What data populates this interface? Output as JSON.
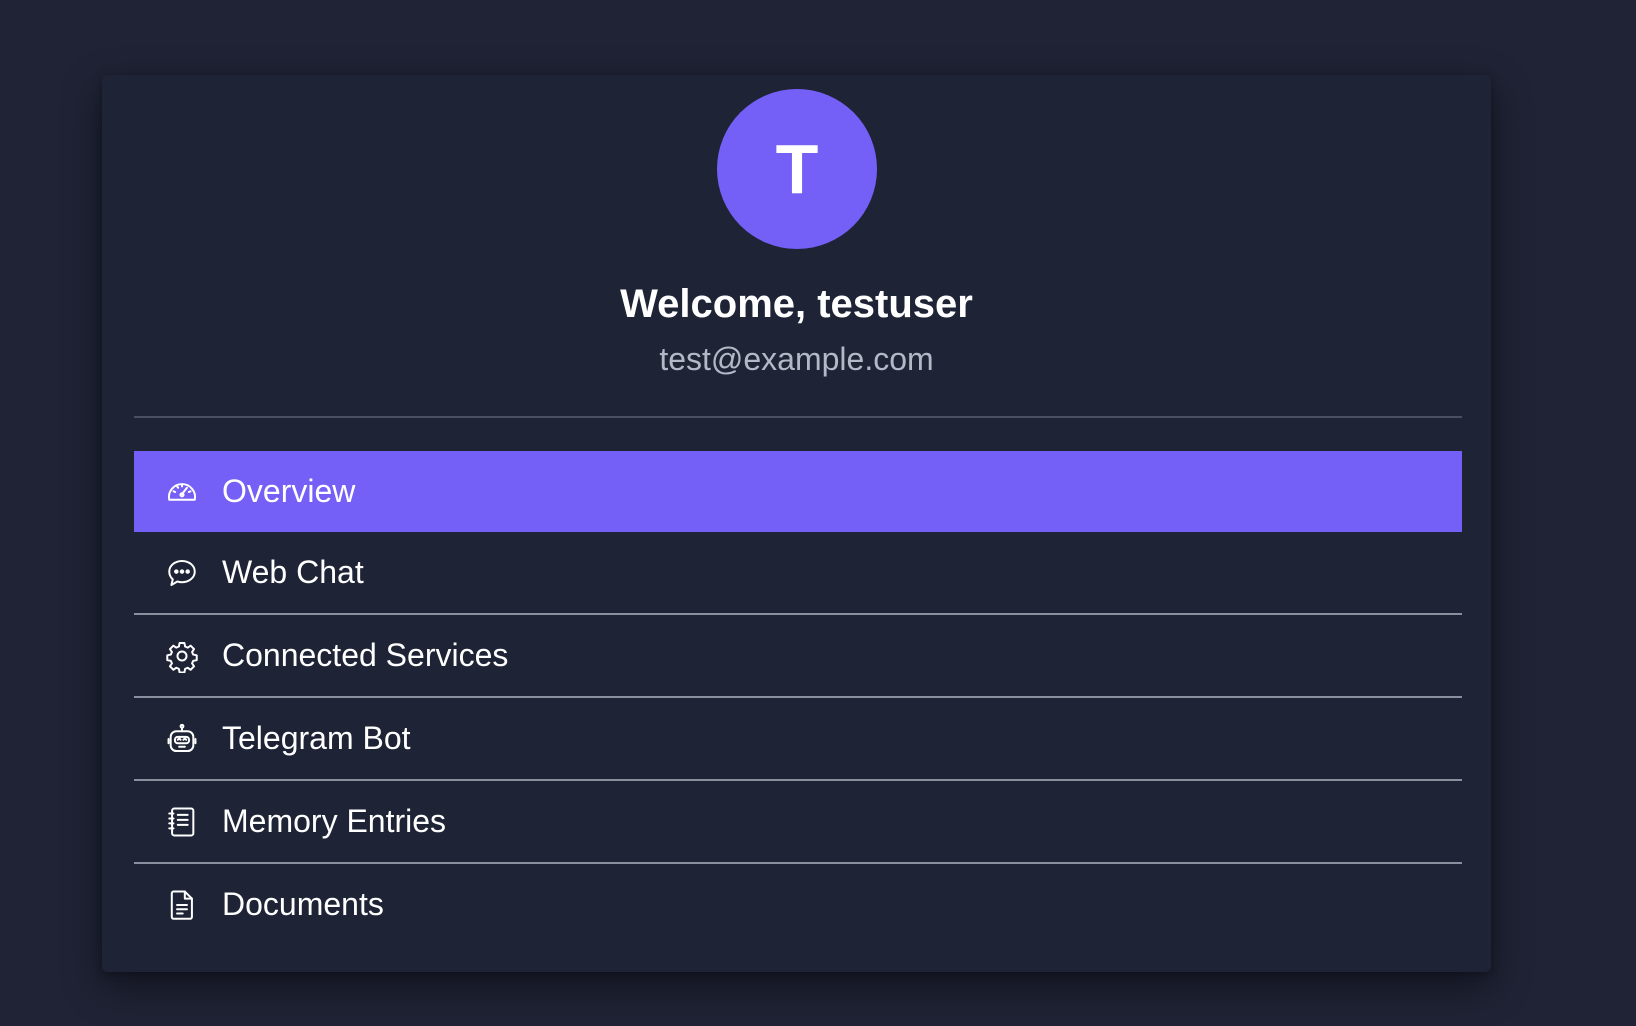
{
  "profile": {
    "avatar_initial": "T",
    "welcome": "Welcome, testuser",
    "email": "test@example.com"
  },
  "menu": {
    "items": [
      {
        "label": "Overview",
        "icon": "dashboard-gauge-icon",
        "active": true
      },
      {
        "label": "Web Chat",
        "icon": "chat-bubble-icon",
        "active": false
      },
      {
        "label": "Connected Services",
        "icon": "gear-icon",
        "active": false
      },
      {
        "label": "Telegram Bot",
        "icon": "robot-icon",
        "active": false
      },
      {
        "label": "Memory Entries",
        "icon": "notebook-icon",
        "active": false
      },
      {
        "label": "Documents",
        "icon": "document-icon",
        "active": false
      }
    ]
  },
  "colors": {
    "background": "#1f2335",
    "card": "#1e2436",
    "accent": "#7560f7",
    "text": "#ffffff",
    "muted_text": "#b4b8c6",
    "divider": "#8a8f9e"
  }
}
